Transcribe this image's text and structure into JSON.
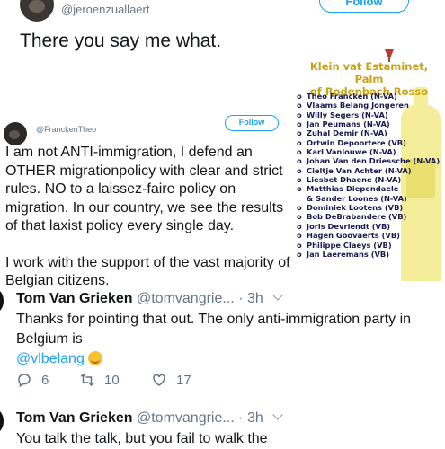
{
  "top_tweet": {
    "handle": "@jeroenzuallaert",
    "follow_label": "Follow",
    "text": "There you say me what."
  },
  "embedded_tweet": {
    "handle": "@FranckenTheo",
    "follow_label": "Follow",
    "paragraph1": "I am not ANTI-immigration, I defend an OTHER migrationpolicy with clear and strict rules. NO to a laissez-faire policy on migration. In our country, we see the results of that laxist policy every single day.",
    "paragraph2": "I work with the support of the vast majority of Belgian citizens."
  },
  "poster": {
    "title_line1": "Klein vat Estaminet, Palm",
    "title_line2": "of Rodenbach Rosso",
    "items": [
      "Theo Francken (N-VA)",
      "Vlaams Belang Jongeren",
      "Willy Segers (N-VA)",
      "Jan Peumans (N-VA)",
      "Zuhal Demir (N-VA)",
      "Ortwin Depoortere (VB)",
      "Karl Vanlouwe (N-VA)",
      "Johan Van den Driessche (N-VA)",
      "Cieltje Van Achter (N-VA)",
      "Liesbet Dhaene (N-VA)",
      "Matthias Diependaele",
      "& Sander Loones (N-VA)",
      "Dominiek Lootens (VB)",
      "Bob DeBrabandere (VB)",
      "Joris Devriendt (VB)",
      "Hagen Goovaerts (VB)",
      "Philippe Claeys (VB)",
      "Jan Laeremans (VB)"
    ]
  },
  "reply1": {
    "name": "Tom Van Grieken",
    "handle": "@tomvangrie...",
    "dot": "·",
    "time": "3h",
    "text": "Thanks for pointing that out. The only anti-immigration party in Belgium is",
    "mention": "@vlbelang",
    "replies": "6",
    "retweets": "10",
    "likes": "17"
  },
  "reply2": {
    "name": "Tom Van Grieken",
    "handle": "@tomvangrie...",
    "dot": "·",
    "time": "3h",
    "text": "You talk the talk, but you fail to walk the"
  },
  "colors": {
    "accent": "#1da1f2",
    "secondary_text": "#657786",
    "poster_title": "#c8a415",
    "poster_list": "#1a1a4e"
  }
}
